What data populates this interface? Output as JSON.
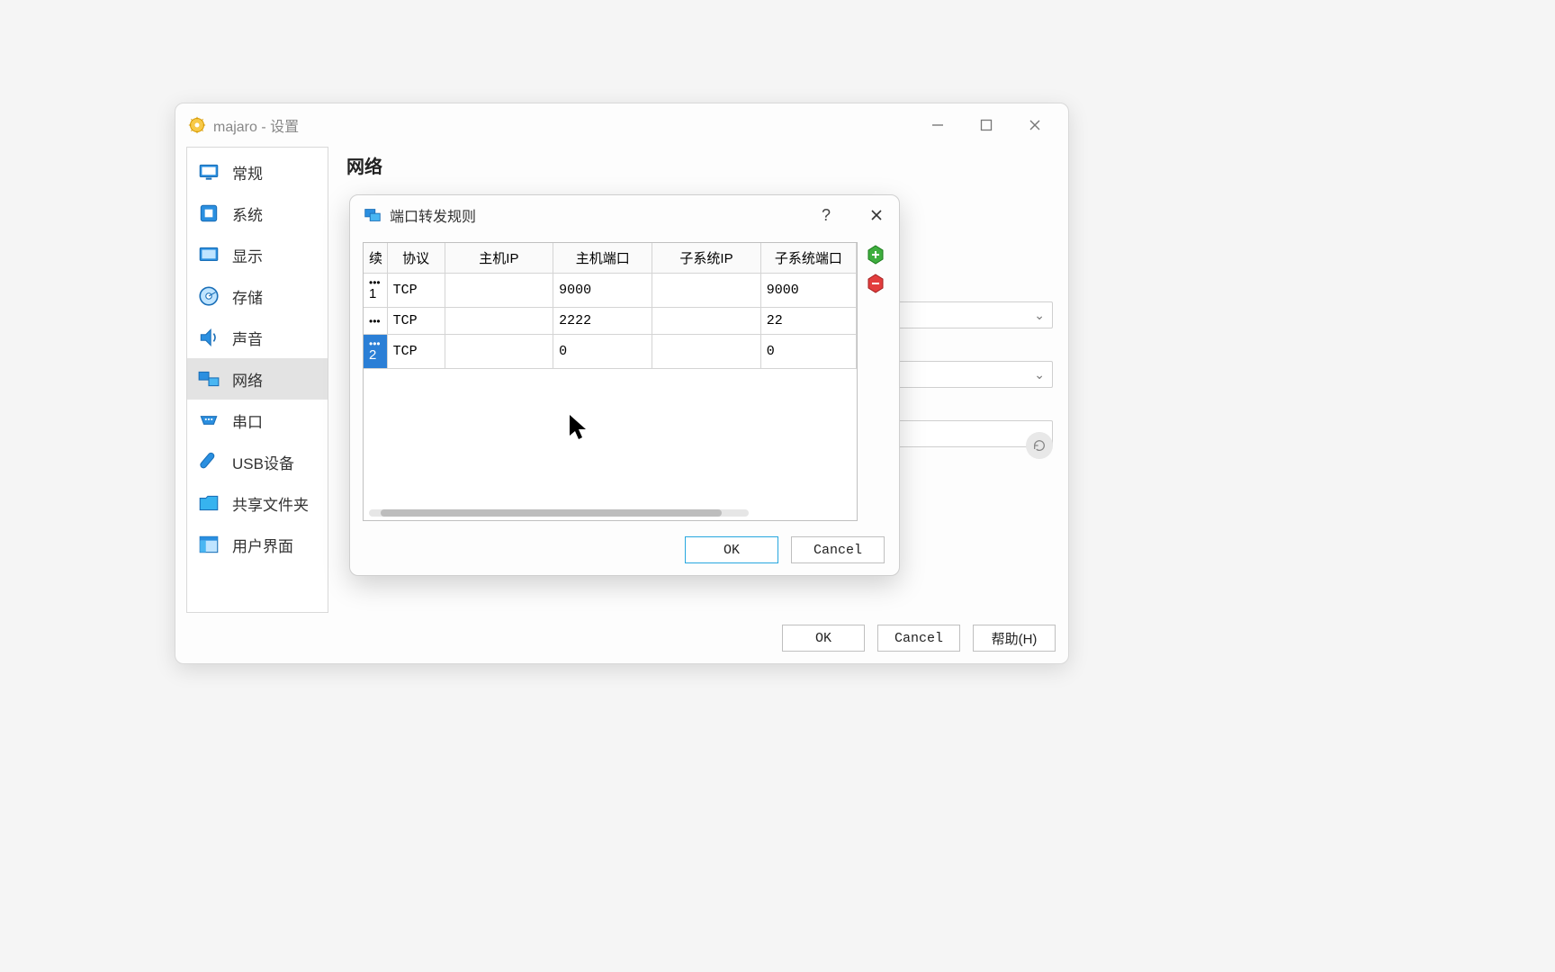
{
  "main": {
    "title": "majaro - 设置",
    "heading": "网络",
    "footer": {
      "ok": "OK",
      "cancel": "Cancel",
      "help": "帮助(H)"
    }
  },
  "sidebar": {
    "items": [
      {
        "label": "常规"
      },
      {
        "label": "系统"
      },
      {
        "label": "显示"
      },
      {
        "label": "存储"
      },
      {
        "label": "声音"
      },
      {
        "label": "网络"
      },
      {
        "label": "串口"
      },
      {
        "label": "USB设备"
      },
      {
        "label": "共享文件夹"
      },
      {
        "label": "用户界面"
      }
    ]
  },
  "dialog": {
    "title": "端口转发规则",
    "columns": [
      "协议",
      "主机IP",
      "主机端口",
      "子系统IP",
      "子系统端口"
    ],
    "corner_header": "续",
    "footer": {
      "ok": "OK",
      "cancel": "Cancel"
    }
  },
  "rules": [
    {
      "idx": "1",
      "protocol": "TCP",
      "host_ip": "",
      "host_port": "9000",
      "guest_ip": "",
      "guest_port": "9000",
      "selected": false
    },
    {
      "idx": "",
      "protocol": "TCP",
      "host_ip": "",
      "host_port": "2222",
      "guest_ip": "",
      "guest_port": "22",
      "selected": false
    },
    {
      "idx": "2",
      "protocol": "TCP",
      "host_ip": "",
      "host_port": "0",
      "guest_ip": "",
      "guest_port": "0",
      "selected": true
    }
  ]
}
